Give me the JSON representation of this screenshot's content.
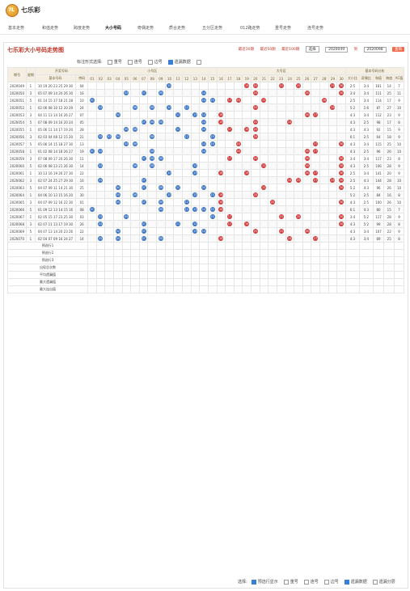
{
  "app": {
    "title": "七乐彩",
    "logo_text": "7L"
  },
  "nav": [
    {
      "label": "基本走势",
      "active": false
    },
    {
      "label": "和值走势",
      "active": false
    },
    {
      "label": "跨度走势",
      "active": false
    },
    {
      "label": "大小号码",
      "active": true
    },
    {
      "label": "奇偶走势",
      "active": false
    },
    {
      "label": "质合走势",
      "active": false
    },
    {
      "label": "五分区走势",
      "active": false
    },
    {
      "label": "012路走势",
      "active": false
    },
    {
      "label": "重号走势",
      "active": false
    },
    {
      "label": "连号走势",
      "active": false
    }
  ],
  "panel": {
    "title": "七乐彩大小号码走势图",
    "recent": [
      "最近30期",
      "最近50期",
      "最近100期"
    ],
    "select_value": "选择",
    "from_issue": "2020049",
    "to_label": "到",
    "to_issue": "2020098",
    "submit": "查询"
  },
  "filters": {
    "label": "标注形式选择:",
    "options": [
      {
        "label": "重号",
        "checked": false
      },
      {
        "label": "连号",
        "checked": false
      },
      {
        "label": "边号",
        "checked": false
      },
      {
        "label": "遗漏数据",
        "checked": true
      },
      {
        "label": "",
        "checked": false
      }
    ]
  },
  "table": {
    "headers": {
      "issue": "期号",
      "weekday": "星期",
      "open": "开奖号码",
      "basic": "基本号码",
      "special": "特码",
      "small_zone": "小号区",
      "big_zone": "大号区",
      "small": "小号",
      "big": "大号",
      "analysis": "基本号码分析",
      "ratio": "大小比",
      "odd_even": "奇偶比",
      "sum": "和值",
      "span": "跨度",
      "ac": "AC值"
    },
    "small_numbers": [
      "01",
      "02",
      "03",
      "04",
      "05",
      "06",
      "07",
      "08",
      "09",
      "10",
      "11",
      "12",
      "13",
      "14",
      "15"
    ],
    "big_numbers": [
      "16",
      "17",
      "18",
      "19",
      "20",
      "21",
      "22",
      "23",
      "24",
      "25",
      "26",
      "27",
      "28",
      "29",
      "30"
    ],
    "rows": [
      {
        "issue": "2020049",
        "week": "1",
        "nums": "10 19 20 23 25 29 30",
        "sp": "04",
        "ratio": "2:5",
        "oe": "3:4",
        "sum": "161",
        "span": "14",
        "ac": "7"
      },
      {
        "issue": "2020050",
        "week": "3",
        "nums": "05 07 09 14 20 26 30",
        "sp": "16",
        "ratio": "3:4",
        "oe": "3:4",
        "sum": "111",
        "span": "25",
        "ac": "11"
      },
      {
        "issue": "2020051",
        "week": "5",
        "nums": "01 14 15 17 18 21 28",
        "sp": "10",
        "ratio": "2:5",
        "oe": "3:4",
        "sum": "114",
        "span": "17",
        "ac": "9"
      },
      {
        "issue": "2020052",
        "week": "1",
        "nums": "02 06 08 10 12 20 29",
        "sp": "24",
        "ratio": "5:2",
        "oe": "1:6",
        "sum": "87",
        "span": "27",
        "ac": "10"
      },
      {
        "issue": "2020053",
        "week": "3",
        "nums": "04 11 13 14 16 26 27",
        "sp": "07",
        "ratio": "4:3",
        "oe": "3:4",
        "sum": "112",
        "span": "23",
        "ac": "9"
      },
      {
        "issue": "2020054",
        "week": "5",
        "nums": "07 08 09 14 16 20 24",
        "sp": "05",
        "ratio": "4:3",
        "oe": "2:5",
        "sum": "98",
        "span": "17",
        "ac": "8"
      },
      {
        "issue": "2020055",
        "week": "1",
        "nums": "05 06 11 14 17 19 20",
        "sp": "28",
        "ratio": "4:3",
        "oe": "4:3",
        "sum": "92",
        "span": "15",
        "ac": "9"
      },
      {
        "issue": "2020056",
        "week": "3",
        "nums": "02 03 04 08 12 15 20",
        "sp": "21",
        "ratio": "6:1",
        "oe": "2:5",
        "sum": "64",
        "span": "18",
        "ac": "9"
      },
      {
        "issue": "2020057",
        "week": "5",
        "nums": "05 06 14 15 18 27 30",
        "sp": "13",
        "ratio": "4:3",
        "oe": "3:4",
        "sum": "115",
        "span": "25",
        "ac": "10"
      },
      {
        "issue": "2020058",
        "week": "1",
        "nums": "01 02 08 14 18 26 27",
        "sp": "19",
        "ratio": "4:3",
        "oe": "2:5",
        "sum": "96",
        "span": "26",
        "ac": "10"
      },
      {
        "issue": "2020059",
        "week": "3",
        "nums": "07 08 09 17 20 26 30",
        "sp": "11",
        "ratio": "3:4",
        "oe": "3:4",
        "sum": "117",
        "span": "23",
        "ac": "8"
      },
      {
        "issue": "2020060",
        "week": "5",
        "nums": "02 06 08 13 21 26 30",
        "sp": "14",
        "ratio": "4:3",
        "oe": "2:5",
        "sum": "106",
        "span": "28",
        "ac": "9"
      },
      {
        "issue": "2020061",
        "week": "1",
        "nums": "10 13 16 19 26 27 30",
        "sp": "22",
        "ratio": "2:5",
        "oe": "3:4",
        "sum": "141",
        "span": "20",
        "ac": "9"
      },
      {
        "issue": "2020062",
        "week": "3",
        "nums": "02 07 24 25 27 29 30",
        "sp": "16",
        "ratio": "2:5",
        "oe": "4:3",
        "sum": "144",
        "span": "28",
        "ac": "10"
      },
      {
        "issue": "2020063",
        "week": "5",
        "nums": "04 07 09 11 14 21 30",
        "sp": "25",
        "ratio": "5:2",
        "oe": "4:3",
        "sum": "96",
        "span": "26",
        "ac": "10"
      },
      {
        "issue": "2020064",
        "week": "1",
        "nums": "04 06 10 13 15 16 20",
        "sp": "30",
        "ratio": "5:2",
        "oe": "2:5",
        "sum": "84",
        "span": "16",
        "ac": "8"
      },
      {
        "issue": "2020065",
        "week": "3",
        "nums": "04 07 09 12 16 22 30",
        "sp": "01",
        "ratio": "4:3",
        "oe": "2:5",
        "sum": "100",
        "span": "26",
        "ac": "10"
      },
      {
        "issue": "2020066",
        "week": "5",
        "nums": "01 09 12 13 14 15 16",
        "sp": "08",
        "ratio": "6:1",
        "oe": "4:3",
        "sum": "80",
        "span": "15",
        "ac": "7"
      },
      {
        "issue": "2020067",
        "week": "1",
        "nums": "02 05 15 17 23 25 30",
        "sp": "03",
        "ratio": "3:4",
        "oe": "5:2",
        "sum": "117",
        "span": "28",
        "ac": "9"
      },
      {
        "issue": "2020068",
        "week": "3",
        "nums": "02 07 11 13 17 19 30",
        "sp": "26",
        "ratio": "4:3",
        "oe": "5:2",
        "sum": "99",
        "span": "28",
        "ac": "8"
      },
      {
        "issue": "2020069",
        "week": "5",
        "nums": "04 07 13 14 20 23 26",
        "sp": "22",
        "ratio": "4:3",
        "oe": "3:4",
        "sum": "107",
        "span": "22",
        "ac": "9"
      },
      {
        "issue": "2020070",
        "week": "1",
        "nums": "02 04 07 09 16 24 27",
        "sp": "14",
        "ratio": "4:3",
        "oe": "3:4",
        "sum": "89",
        "span": "25",
        "ac": "8"
      }
    ],
    "forecast": [
      "预选行1",
      "预选行2",
      "预选行3"
    ],
    "stats_labels": [
      "出现总次数",
      "平均遗漏值",
      "最大遗漏值",
      "最大连出值"
    ]
  },
  "bottom": {
    "label": "选择:",
    "options": [
      {
        "label": "预选行显示",
        "checked": true
      },
      {
        "label": "重号",
        "checked": false
      },
      {
        "label": "连号",
        "checked": false
      },
      {
        "label": "边号",
        "checked": false
      },
      {
        "label": "遗漏数据",
        "checked": true
      },
      {
        "label": "遗漏分层",
        "checked": false
      }
    ]
  },
  "colors": {
    "accent": "#c0392b",
    "ball_red": "#d23c3c",
    "ball_blue": "#3d76c6",
    "header_bg": "#f4efe2"
  }
}
